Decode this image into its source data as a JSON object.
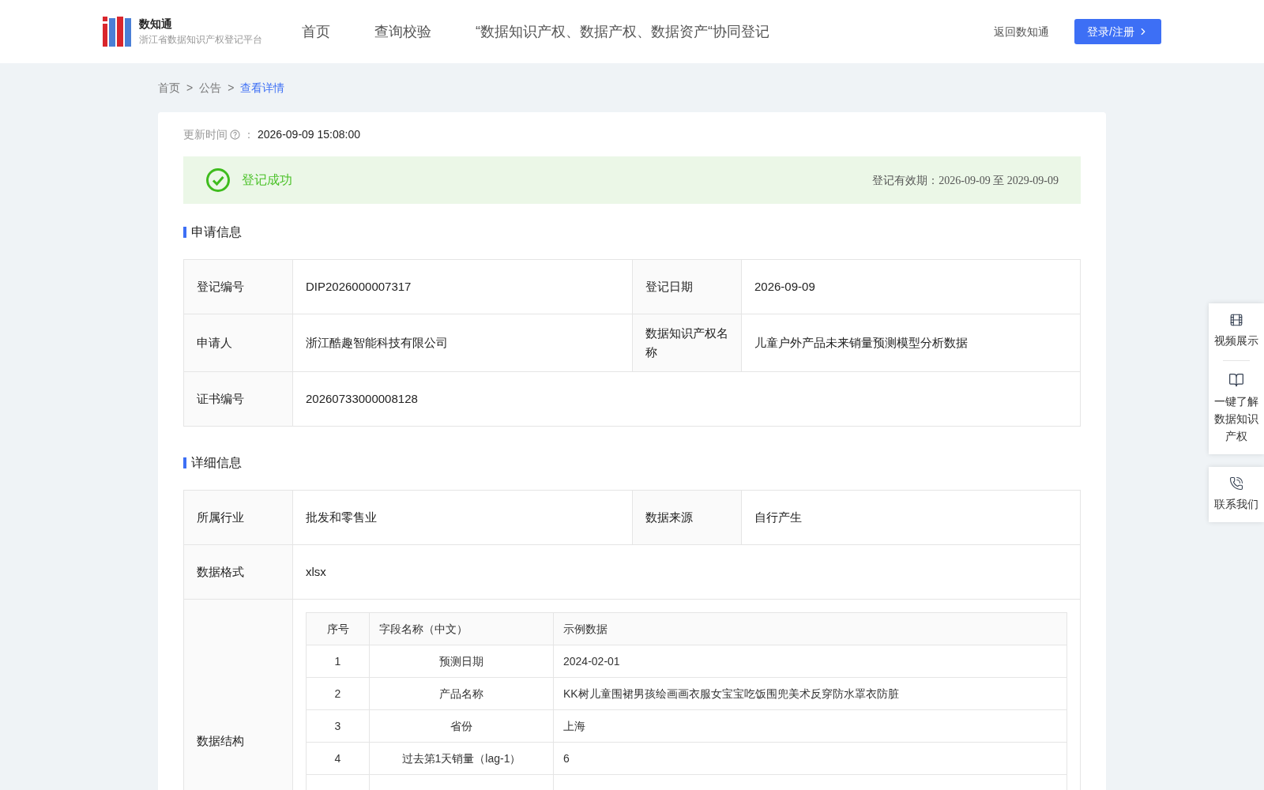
{
  "header": {
    "logo_title": "数知通",
    "logo_subtitle": "浙江省数据知识产权登记平台",
    "nav": [
      {
        "label": "首页",
        "selected": false
      },
      {
        "label": "查询校验",
        "selected": false
      },
      {
        "label": "“数据知识产权、数据产权、数据资产“协同登记",
        "selected": false
      }
    ],
    "back_link": "返回数知通",
    "login_button": "登录/注册"
  },
  "breadcrumb": [
    {
      "label": "首页",
      "selected": false
    },
    {
      "label": "公告",
      "selected": false
    },
    {
      "label": "查看详情",
      "selected": true
    }
  ],
  "breadcrumb_separator": ">",
  "update_time": {
    "label": "更新时间",
    "colon": "：",
    "value": "2026-09-09 15:08:00"
  },
  "status": {
    "text": "登记成功",
    "validity": "登记有效期：2026-09-09 至 2029-09-09"
  },
  "application_info": {
    "title": "申请信息",
    "rows": [
      {
        "cells": [
          {
            "label": "登记编号",
            "value": "DIP2026000007317"
          },
          {
            "label": "登记日期",
            "value": "2026-09-09"
          }
        ]
      },
      {
        "cells": [
          {
            "label": "申请人",
            "value": "浙江酷趣智能科技有限公司"
          },
          {
            "label": "数据知识产权名称",
            "value": "儿童户外产品未来销量预测模型分析数据"
          }
        ]
      },
      {
        "cells": [
          {
            "label": "证书编号",
            "value": "20260733000008128"
          }
        ]
      }
    ]
  },
  "detail_info": {
    "title": "详细信息",
    "rows": [
      {
        "cells": [
          {
            "label": "所属行业",
            "value": "批发和零售业"
          },
          {
            "label": "数据来源",
            "value": "自行产生"
          }
        ]
      },
      {
        "cells": [
          {
            "label": "数据格式",
            "value": "xlsx"
          }
        ]
      }
    ],
    "structure": {
      "label": "数据结构",
      "columns": [
        "序号",
        "字段名称（中文）",
        "示例数据"
      ],
      "rows": [
        [
          "1",
          "预测日期",
          "2024-02-01"
        ],
        [
          "2",
          "产品名称",
          "KK树儿童围裙男孩绘画画衣服女宝宝吃饭围兜美术反穿防水罩衣防脏"
        ],
        [
          "3",
          "省份",
          "上海"
        ],
        [
          "4",
          "过去第1天销量（lag-1）",
          "6"
        ]
      ]
    }
  },
  "side_panel": [
    {
      "kind": "video",
      "label": "视频展示"
    },
    {
      "kind": "book",
      "label": "一键了解数据知识产权"
    },
    {
      "kind": "phone",
      "label": "联系我们"
    }
  ]
}
